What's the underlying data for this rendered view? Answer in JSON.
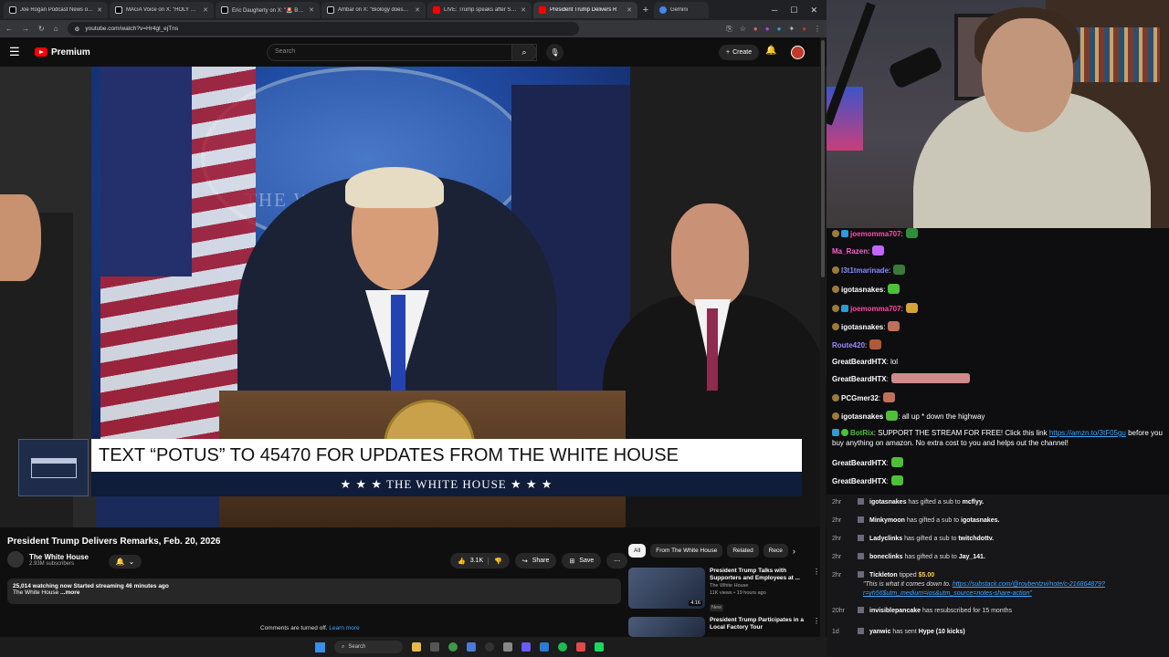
{
  "browser": {
    "tabs": [
      {
        "label": "Joe Rogan Podcast News on X",
        "color": "#e8e8e8"
      },
      {
        "label": "MAGA Voice on X: \"HOLY SH*T",
        "color": "#e8e8e8"
      },
      {
        "label": "Eric Daugherty on X: \"🚨 BREAK",
        "color": "#e8e8e8"
      },
      {
        "label": "Ambar on X: \"Biology doesn't c",
        "color": "#e8e8e8"
      },
      {
        "label": "LIVE: Trump speaks after Supr",
        "color": "#ff0000"
      },
      {
        "label": "President Trump Delivers R",
        "color": "#ff0000"
      },
      {
        "label": "Gemini",
        "color": "#4285f4"
      }
    ],
    "new_tab": "+",
    "url": "youtube.com/watch?v=Hr4gl_ejTns"
  },
  "youtube": {
    "logo_text": "Premium",
    "search_placeholder": "Search",
    "create_label": "Create",
    "video": {
      "seal_text": "THE WHITE HOUSE",
      "banner_text": "TEXT “POTUS” TO 45470 FOR UPDATES FROM THE WHITE HOUSE",
      "banner_sub": "★ ★ ★  THE WHITE HOUSE  ★ ★ ★"
    },
    "title": "President Trump Delivers Remarks, Feb. 20, 2026",
    "channel": {
      "name": "The White House",
      "subs": "2.93M subscribers"
    },
    "actions": {
      "likes": "3.1K",
      "share": "Share",
      "save": "Save"
    },
    "description": {
      "watching": "25,014 watching now",
      "started": "Started streaming 46 minutes ago",
      "channel": "The White House",
      "more": "...more"
    },
    "comments": {
      "text": "Comments are turned off.",
      "link": "Learn more"
    },
    "chips": [
      "All",
      "From The White House",
      "Related",
      "Rece"
    ],
    "recommendations": [
      {
        "title": "President Trump Talks with Supporters and Employees at ...",
        "channel": "The White House",
        "meta": "11K views • 19 hours ago",
        "badge": "New",
        "duration": "4:16"
      },
      {
        "title": "President Trump Participates in a Local Factory Tour",
        "channel": "",
        "meta": "",
        "badge": "",
        "duration": ""
      }
    ]
  },
  "taskbar": {
    "search_label": "Search"
  },
  "chat": {
    "messages": [
      {
        "user": "joemomma707",
        "color": "#ff4da6",
        "text": ":",
        "emote": "#2c8f3a"
      },
      {
        "user": "Ma_Razen",
        "color": "#ff5fd2",
        "text": ":",
        "emote": "#c266ff"
      },
      {
        "user": "l3t1tmarinade",
        "color": "#8a8aff",
        "text": ":",
        "emote": "#3a7a3a"
      },
      {
        "user": "igotasnakes",
        "color": "#ffffff",
        "text": ":",
        "emote": "#4fbf3a"
      },
      {
        "user": "joemomma707",
        "color": "#ff4da6",
        "text": ":",
        "emote": "#d6a23a"
      },
      {
        "user": "igotasnakes",
        "color": "#ffffff",
        "text": ":",
        "emote": "#c0705a"
      },
      {
        "user": "Route420",
        "color": "#9b8aff",
        "text": ":",
        "emote": "#b05a3a"
      },
      {
        "user": "GreatBeardHTX",
        "color": "#ffffff",
        "text": ": lol",
        "emote": ""
      },
      {
        "user": "GreatBeardHTX",
        "color": "#ffffff",
        "text": ":",
        "emote": "#d08a8a"
      },
      {
        "user": "PCGmer32",
        "color": "#ffffff",
        "text": ":",
        "emote": "#c0705a"
      },
      {
        "user": "igotasnakes",
        "color": "#ffffff",
        "text": ": all up * down the highway",
        "emote": "#4fbf3a"
      },
      {
        "user": "BotRix",
        "color": "#4fbf3a",
        "text": ": SUPPORT THE STREAM FOR FREE! Click this link",
        "link": "https://amzn.to/3tF05gu",
        "cont": "before you buy anything on amazon. No extra cost to you and helps out the channel!"
      },
      {
        "user": "GreatBeardHTX",
        "color": "#ffffff",
        "text": ":",
        "emote": "#4fbf3a"
      },
      {
        "user": "GreatBeardHTX",
        "color": "#ffffff",
        "text": ":",
        "emote": "#4fbf3a"
      }
    ],
    "events": [
      {
        "time": "2hr",
        "user": "igotasnakes",
        "text": "has gifted a sub to",
        "target": "mcflyy."
      },
      {
        "time": "2hr",
        "user": "Minkymoon",
        "text": "has gifted a sub to",
        "target": "igotasnakes."
      },
      {
        "time": "2hr",
        "user": "Ladyclinks",
        "text": "has gifted a sub to",
        "target": "twitchdottv."
      },
      {
        "time": "2hr",
        "user": "boneclinks",
        "text": "has gifted a sub to",
        "target": "Jay_141."
      },
      {
        "time": "2hr",
        "user": "Tickleton",
        "text": "tipped",
        "target": "$5.00",
        "quote": "\"This is what it comes down to.",
        "link": "https://substack.com/@roybentzvi/note/c-216864879?r=yh56$utm_medium=ios&utm_source=notes-share-action\""
      },
      {
        "time": "20hr",
        "user": "invisiblepancake",
        "text": "has resubscribed for 15 months",
        "target": ""
      },
      {
        "time": "1d",
        "user": "yanwic",
        "text": "has sent",
        "target": "Hype (10 kicks)"
      }
    ]
  }
}
